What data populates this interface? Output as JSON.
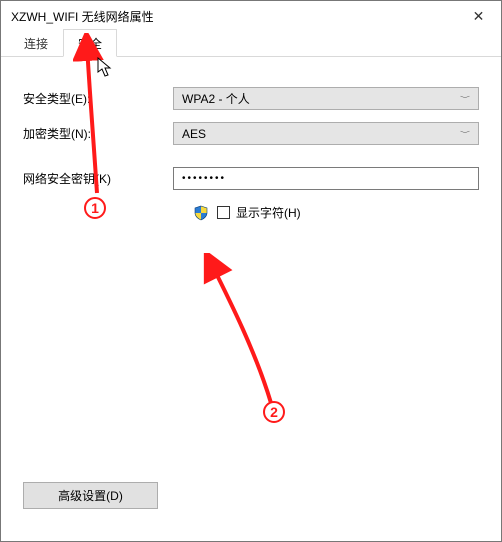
{
  "window": {
    "title": "XZWH_WIFI 无线网络属性"
  },
  "tabs": {
    "connect": "连接",
    "security": "安全"
  },
  "form": {
    "securityTypeLabel": "安全类型(E):",
    "securityTypeValue": "WPA2 - 个人",
    "encryptionTypeLabel": "加密类型(N):",
    "encryptionTypeValue": "AES",
    "passwordLabel": "网络安全密钥(K)",
    "passwordValue": "••••••••",
    "showCharsLabel": "显示字符(H)"
  },
  "buttons": {
    "advanced": "高级设置(D)"
  },
  "annotations": {
    "step1": "1",
    "step2": "2"
  }
}
